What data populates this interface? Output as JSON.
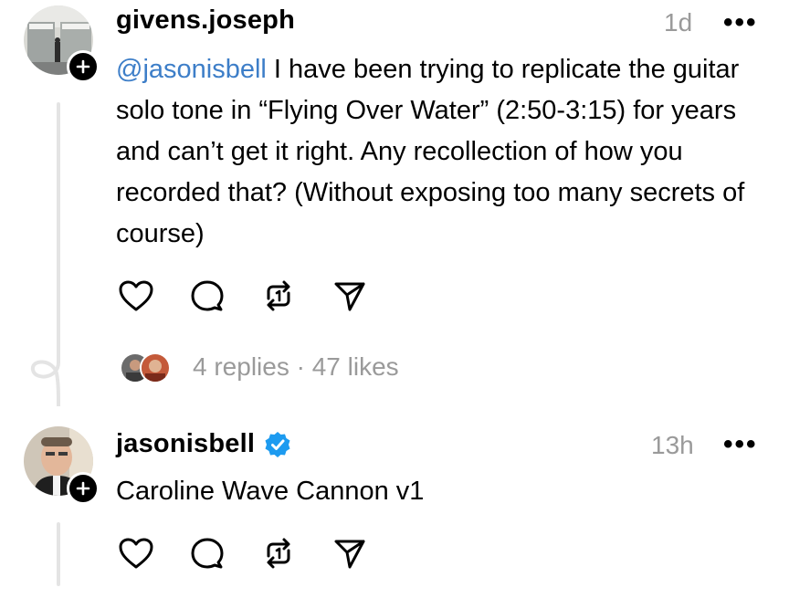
{
  "post": {
    "username": "givens.joseph",
    "time": "1d",
    "more": "•••",
    "mention": "@jasonisbell",
    "body": " I have been trying to replicate the guitar solo tone in “Flying Over Water” (2:50-3:15) for years and can’t get it right. Any recollection of how you recorded that? (Without exposing too many secrets of course)",
    "stats": "4 replies · 47 likes",
    "actions": [
      "heart-icon",
      "comment-icon",
      "repost-icon",
      "share-icon"
    ]
  },
  "reply": {
    "username": "jasonisbell",
    "verified": true,
    "time": "13h",
    "more": "•••",
    "body": "Caroline Wave Cannon v1",
    "actions": [
      "heart-icon",
      "comment-icon",
      "repost-icon",
      "share-icon"
    ]
  },
  "colors": {
    "mention": "#3d7ec8",
    "verified": "#1d9bf0",
    "muted": "#9a9a9a",
    "thread_line": "#e4e4e4"
  }
}
